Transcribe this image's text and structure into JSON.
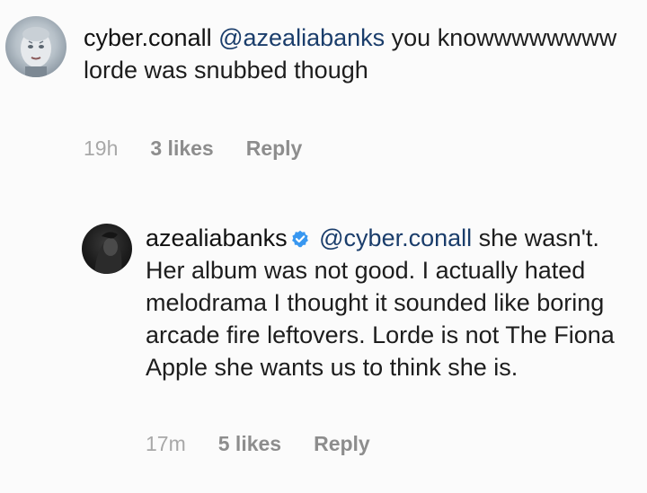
{
  "comments": [
    {
      "username": "cyber.conall",
      "mention": "@azealiabanks",
      "text": "you knowwwwwwww lorde was snubbed though",
      "time": "19h",
      "likes": "3 likes",
      "reply_label": "Reply",
      "avatar_icon": "profile-avatar"
    },
    {
      "username": "azealiabanks",
      "verified": true,
      "verified_icon": "verified-badge-icon",
      "verified_color": "#3897f0",
      "mention": "@cyber.conall",
      "text": "she wasn't. Her album was not good. I actually hated melodrama I thought it sounded like boring arcade fire leftovers. Lorde is not The Fiona Apple she wants us to think she is.",
      "time": "17m",
      "likes": "5 likes",
      "reply_label": "Reply",
      "avatar_icon": "profile-avatar"
    }
  ]
}
